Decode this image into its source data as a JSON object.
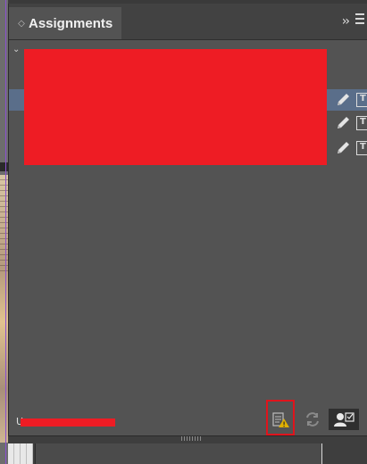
{
  "panel": {
    "title": "Assignments",
    "grip_glyph": "◇",
    "chevrons_glyph": "››",
    "group_chevron": "⌄",
    "group_label": "",
    "footer_label": "U"
  },
  "rows": [
    {
      "label": "",
      "selected": true
    },
    {
      "label": "",
      "selected": false
    },
    {
      "label": "",
      "selected": false
    }
  ],
  "icons": {
    "pencil": "pencil-icon",
    "text_frame": "text-frame-icon",
    "warning": "assignment-warning-icon",
    "refresh": "refresh-icon",
    "user": "user-icon",
    "menu": "panel-menu-icon"
  },
  "colors": {
    "panel_bg": "#535353",
    "header_bg": "#424242",
    "selection": "#5a6e8a",
    "redaction": "#ee1c24",
    "highlight_border": "#e0141c",
    "warning": "#e0b000"
  }
}
